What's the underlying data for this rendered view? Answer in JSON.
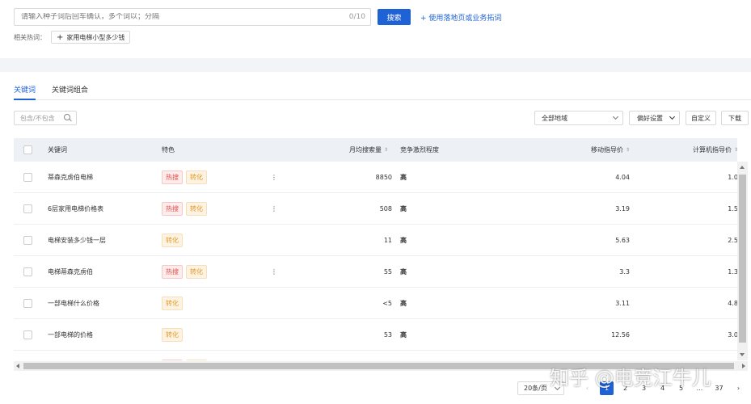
{
  "search": {
    "placeholder": "请输入种子词后回车确认，多个词以；分隔",
    "count": "0/10",
    "button": "搜索",
    "landing_link": "+ 使用落地页或业务拓词"
  },
  "hot_words": {
    "label": "相关热词：",
    "tag": "家用电梯小型多少钱"
  },
  "tabs": [
    {
      "label": "关键词",
      "active": true
    },
    {
      "label": "关键词组合",
      "active": false
    }
  ],
  "filter": {
    "placeholder": "包含/不包含"
  },
  "toolbar": {
    "region": "全部地域",
    "preference": "偏好设置",
    "custom": "自定义",
    "download": "下载"
  },
  "table": {
    "headers": {
      "keyword": "关键词",
      "feature": "特色",
      "monthly_search": "月均搜索量",
      "competition": "竞争激烈程度",
      "mobile_price": "移动指导价",
      "pc_price": "计算机指导价"
    },
    "rows": [
      {
        "keyword": "蒂森克虏伯电梯",
        "tags": [
          "热搜",
          "转化"
        ],
        "more": "⋮",
        "search": "8850",
        "competition": "高",
        "mobile": "4.04",
        "pc": "1.0"
      },
      {
        "keyword": "6层家用电梯价格表",
        "tags": [
          "热搜",
          "转化"
        ],
        "more": "⋮",
        "search": "508",
        "competition": "高",
        "mobile": "3.19",
        "pc": "1.5"
      },
      {
        "keyword": "电梯安装多少钱一层",
        "tags": [
          "转化"
        ],
        "more": "",
        "search": "11",
        "competition": "高",
        "mobile": "5.63",
        "pc": "2.5"
      },
      {
        "keyword": "电梯蒂森克虏伯",
        "tags": [
          "热搜",
          "转化"
        ],
        "more": "⋮",
        "search": "55",
        "competition": "高",
        "mobile": "3.3",
        "pc": "1.3"
      },
      {
        "keyword": "一部电梯什么价格",
        "tags": [
          "转化"
        ],
        "more": "",
        "search": "<5",
        "competition": "高",
        "mobile": "3.11",
        "pc": "4.8"
      },
      {
        "keyword": "一部电梯的价格",
        "tags": [
          "转化"
        ],
        "more": "",
        "search": "53",
        "competition": "高",
        "mobile": "12.56",
        "pc": "3.0"
      },
      {
        "keyword": "",
        "tags": [
          "热搜",
          "转化"
        ],
        "more": "",
        "search": "",
        "competition": "",
        "mobile": "",
        "pc": ""
      }
    ]
  },
  "tag_labels": {
    "热搜": "热搜",
    "转化": "转化"
  },
  "pagination": {
    "page_size": "20条/页",
    "prev": "‹",
    "pages": [
      "1",
      "2",
      "3",
      "4",
      "5",
      "...",
      "37"
    ],
    "active": "1",
    "next": "›"
  },
  "watermark": "知乎 @电竞江牛儿",
  "colors": {
    "accent": "#1f62d6",
    "hot": "#e4514b",
    "conv": "#e49a2b"
  }
}
